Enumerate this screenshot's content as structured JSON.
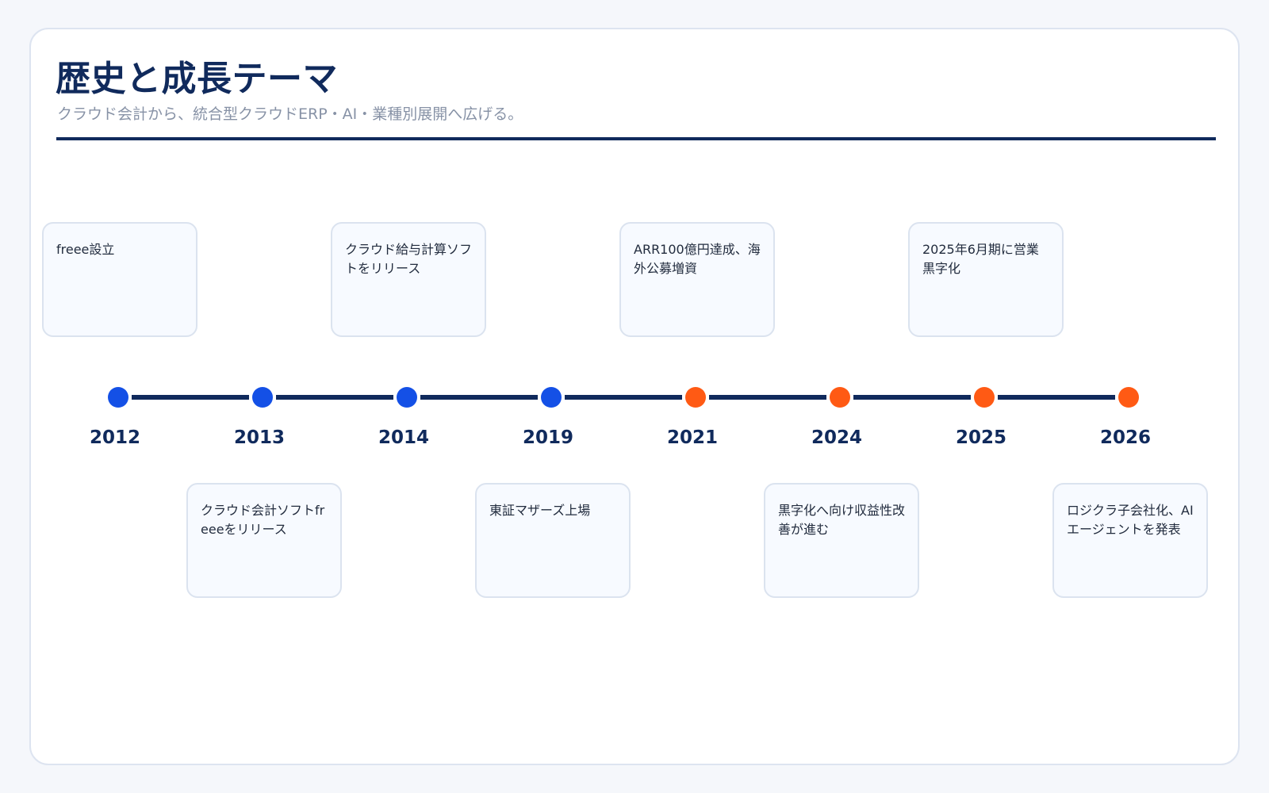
{
  "header": {
    "title": "歴史と成長テーマ",
    "subtitle": "クラウド会計から、統合型クラウドERP・AI・業種別展開へ広げる。"
  },
  "colors": {
    "past": "#1450e6",
    "recent": "#ff5a14",
    "line": "#102a5c"
  },
  "timeline": {
    "events": [
      {
        "year": "2012",
        "text": "freee設立",
        "period": "past",
        "side": "above"
      },
      {
        "year": "2013",
        "text": "クラウド会計ソフトfreeeをリリース",
        "period": "past",
        "side": "below"
      },
      {
        "year": "2014",
        "text": "クラウド給与計算ソフトをリリース",
        "period": "past",
        "side": "above"
      },
      {
        "year": "2019",
        "text": "東証マザーズ上場",
        "period": "past",
        "side": "below"
      },
      {
        "year": "2021",
        "text": "ARR100億円達成、海外公募増資",
        "period": "recent",
        "side": "above"
      },
      {
        "year": "2024",
        "text": "黒字化へ向け収益性改善が進む",
        "period": "recent",
        "side": "below"
      },
      {
        "year": "2025",
        "text": "2025年6月期に営業黒字化",
        "period": "recent",
        "side": "above"
      },
      {
        "year": "2026",
        "text": "ロジクラ子会社化、AIエージェントを発表",
        "period": "recent",
        "side": "below"
      }
    ]
  }
}
